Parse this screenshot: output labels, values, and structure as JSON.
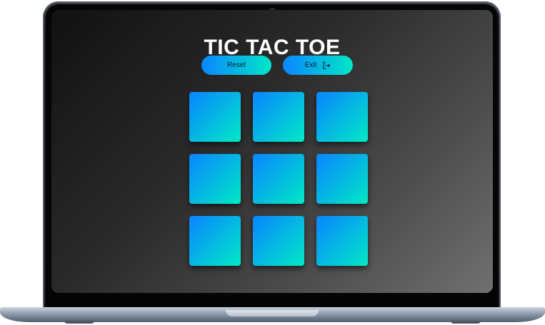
{
  "app": {
    "title": "TIC TAC TOE"
  },
  "controls": {
    "reset_label": "Reset",
    "exit_label": "Exit",
    "exit_icon": "exit-icon"
  },
  "board": {
    "rows": 3,
    "cols": 3,
    "cells": [
      "",
      "",
      "",
      "",
      "",
      "",
      "",
      "",
      ""
    ]
  },
  "theme": {
    "accent_start": "#0a84ff",
    "accent_end": "#00e9c5",
    "title_color": "#ffffff",
    "background_dark": "#111111",
    "background_light": "#707070"
  }
}
